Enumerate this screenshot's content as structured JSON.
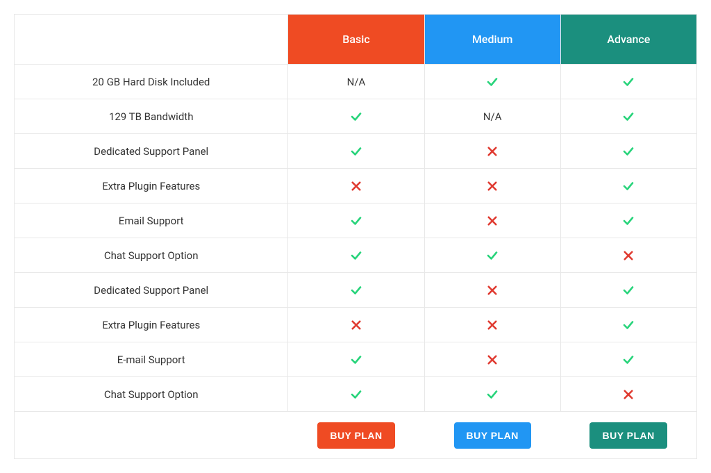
{
  "plans": {
    "basic": {
      "label": "Basic",
      "buy_label": "BUY PLAN"
    },
    "medium": {
      "label": "Medium",
      "buy_label": "BUY PLAN"
    },
    "advance": {
      "label": "Advance",
      "buy_label": "BUY PLAN"
    }
  },
  "na_text": "N/A",
  "features": [
    {
      "label": "20 GB Hard Disk Included",
      "basic": "na",
      "medium": "check",
      "advance": "check"
    },
    {
      "label": "129 TB Bandwidth",
      "basic": "check",
      "medium": "na",
      "advance": "check"
    },
    {
      "label": "Dedicated Support Panel",
      "basic": "check",
      "medium": "cross",
      "advance": "check"
    },
    {
      "label": "Extra Plugin Features",
      "basic": "cross",
      "medium": "cross",
      "advance": "check"
    },
    {
      "label": "Email Support",
      "basic": "check",
      "medium": "cross",
      "advance": "check"
    },
    {
      "label": "Chat Support Option",
      "basic": "check",
      "medium": "check",
      "advance": "cross"
    },
    {
      "label": "Dedicated Support Panel",
      "basic": "check",
      "medium": "cross",
      "advance": "check"
    },
    {
      "label": "Extra Plugin Features",
      "basic": "cross",
      "medium": "cross",
      "advance": "check"
    },
    {
      "label": "E-mail Support",
      "basic": "check",
      "medium": "cross",
      "advance": "check"
    },
    {
      "label": "Chat Support Option",
      "basic": "check",
      "medium": "check",
      "advance": "cross"
    }
  ],
  "colors": {
    "basic": "#ef4b23",
    "medium": "#2196f3",
    "advance": "#1b8f7e",
    "check": "#28d47b",
    "cross": "#e03a30"
  }
}
